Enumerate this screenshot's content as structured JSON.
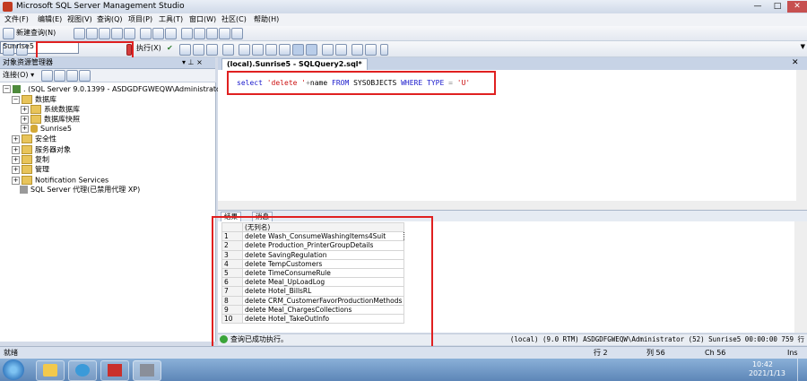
{
  "window": {
    "title": "Microsoft SQL Server Management Studio",
    "min": "—",
    "max": "□",
    "close": "✕"
  },
  "menu": [
    "文件(F)",
    "编辑(E)",
    "视图(V)",
    "查询(Q)",
    "项目(P)",
    "工具(T)",
    "窗口(W)",
    "社区(C)",
    "帮助(H)"
  ],
  "toolbar1": {
    "new_query": "新建查询(N)"
  },
  "toolbar2": {
    "database": "Sunrise5",
    "execute": "执行(X)"
  },
  "object_explorer": {
    "title": "对象资源管理器",
    "pin": "▾ ⊥ ×",
    "connect": "连接(O) ▾",
    "tree": [
      {
        "label": ". (SQL Server 9.0.1399 - ASDGDFGWEQW\\Administrator)",
        "exp": "−",
        "icon": "server-icon"
      },
      {
        "label": "数据库",
        "exp": "−",
        "icon": "folder-icon"
      },
      {
        "label": "系统数据库",
        "exp": "+",
        "icon": "folder-icon"
      },
      {
        "label": "数据库快照",
        "exp": "+",
        "icon": "folder-icon"
      },
      {
        "label": "Sunrise5",
        "exp": "+",
        "icon": "database-icon"
      },
      {
        "label": "安全性",
        "exp": "+",
        "icon": "folder-icon"
      },
      {
        "label": "服务器对象",
        "exp": "+",
        "icon": "folder-icon"
      },
      {
        "label": "复制",
        "exp": "+",
        "icon": "folder-icon"
      },
      {
        "label": "管理",
        "exp": "+",
        "icon": "folder-icon"
      },
      {
        "label": "Notification Services",
        "exp": "+",
        "icon": "folder-icon"
      },
      {
        "label": "SQL Server 代理(已禁用代理 XP)",
        "exp": "",
        "icon": "agent-icon"
      }
    ]
  },
  "editor": {
    "tab_label": "(local).Sunrise5 - SQLQuery2.sql*",
    "tab_close": "✕",
    "sql": {
      "select": "select",
      "lit1": "'delete '",
      "plus": "+",
      "name": "name",
      "from": "FROM",
      "table": "SYSOBJECTS",
      "where": "WHERE",
      "col": "TYPE",
      "eq": "=",
      "lit2": "'U'"
    }
  },
  "results": {
    "tabs": [
      "结果",
      "消息"
    ],
    "column": "(无列名)",
    "rows": [
      "delete Wash_ConsumeWashingItems4Suit",
      "delete Production_PrinterGroupDetails",
      "delete SavingRegulation",
      "delete TempCustomers",
      "delete TimeConsumeRule",
      "delete Meal_UpLoadLog",
      "delete Hotel_BillsRL",
      "delete CRM_CustomerFavorProductionMethods",
      "delete Meal_ChargesCollections",
      "delete Hotel_TakeOutInfo"
    ]
  },
  "query_status": {
    "message": "查询已成功执行。",
    "info": "(local) (9.0 RTM)  ASDGDFGWEQW\\Administrator (52)  Sunrise5  00:00:00  759 行"
  },
  "status_bar": {
    "ready": "就绪",
    "line": "行 2",
    "col": "列 56",
    "ch": "Ch 56",
    "ins": "Ins"
  },
  "taskbar": {
    "time": "10:42",
    "date": "2021/1/13"
  },
  "colors": {
    "highlight_box": "#e02020",
    "keyword": "#1a1acc",
    "string": "#cc1111"
  }
}
